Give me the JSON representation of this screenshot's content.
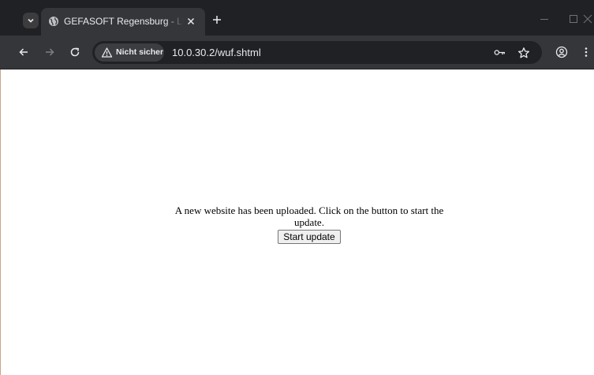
{
  "browser": {
    "tab": {
      "title": "GEFASOFT Regensburg - LUCON Control"
    },
    "toolbar": {
      "security_label": "Nicht sicher",
      "url": "10.0.30.2/wuf.shtml"
    }
  },
  "page": {
    "message": "A new website has been uploaded. Click on the button to start the update.",
    "button_label": "Start update"
  },
  "colors": {
    "tabstrip_bg": "#202124",
    "toolbar_bg": "#35363a",
    "omnibox_bg": "#202124",
    "chrome_text": "#e8eaed",
    "page_bg": "#ffffff"
  }
}
